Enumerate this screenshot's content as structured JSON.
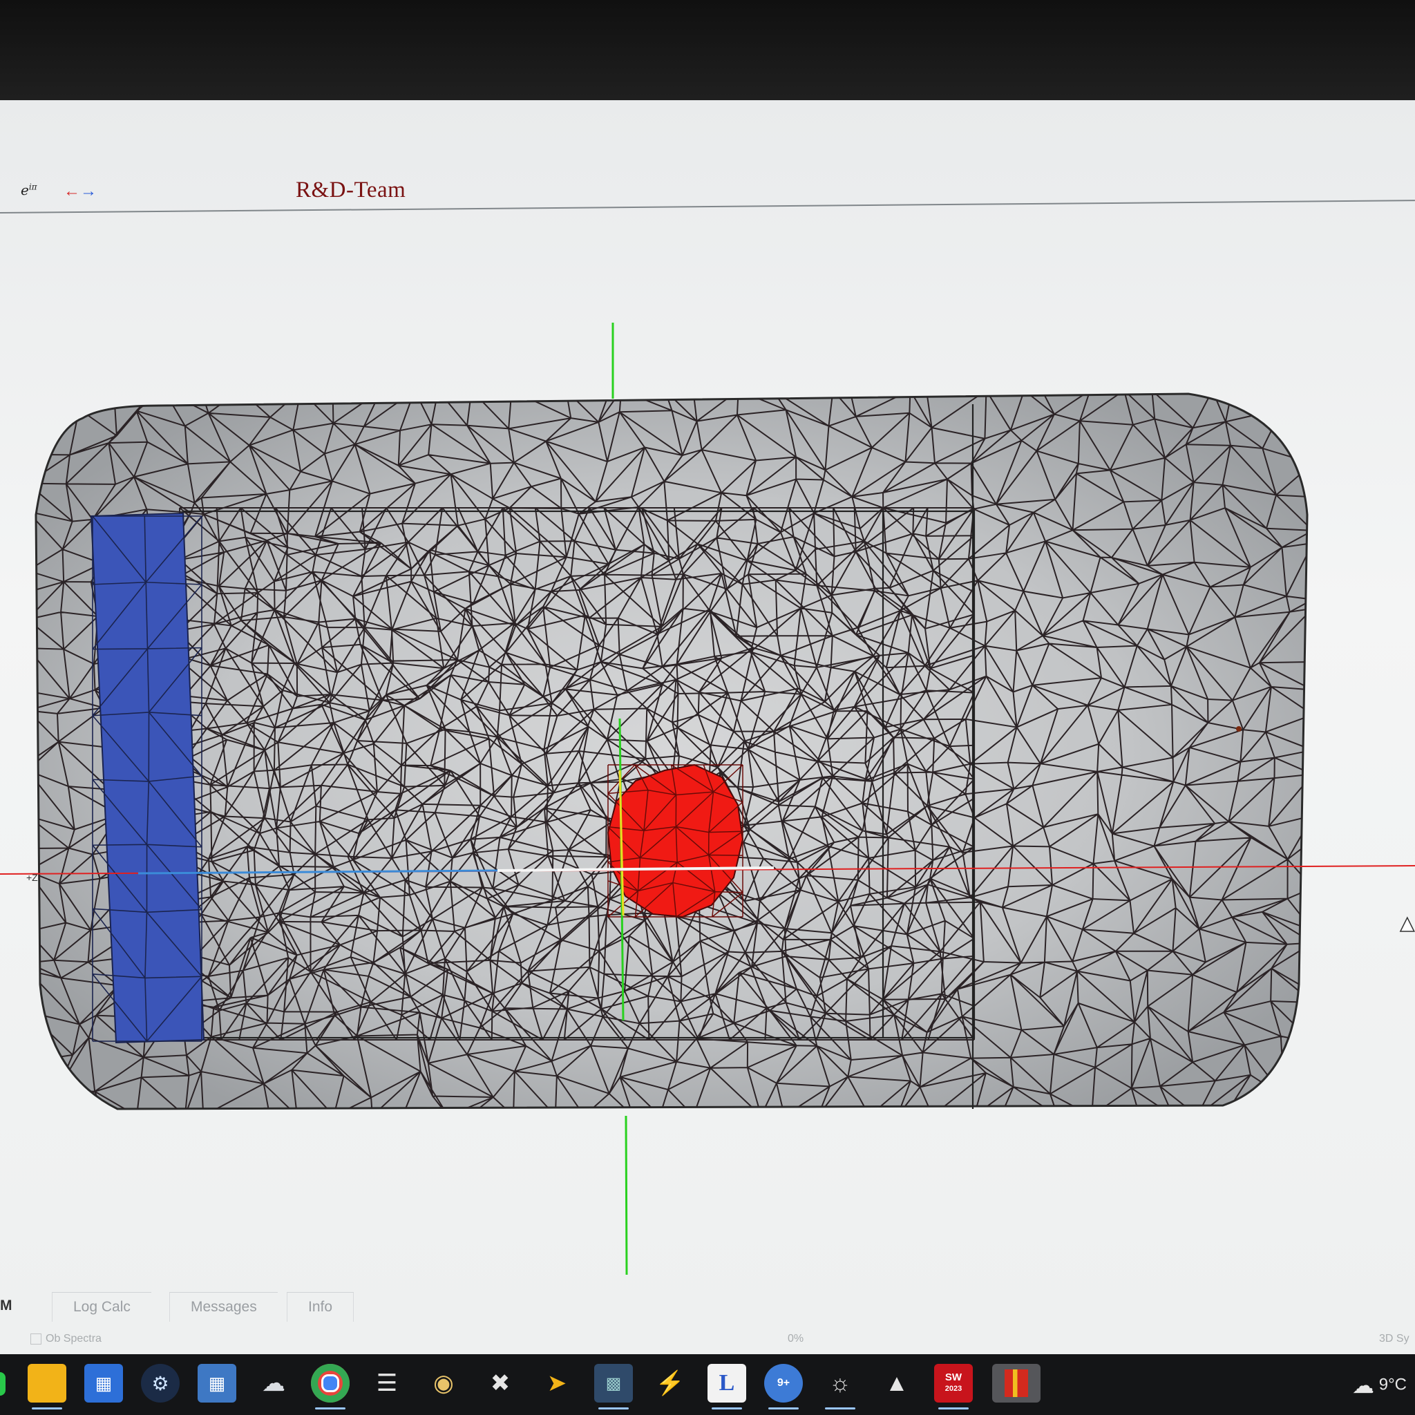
{
  "header": {
    "euler_symbol": "e",
    "euler_exponent": "iπ",
    "arrows_icon": "swap-arrows-icon",
    "title": "R&D-Team"
  },
  "axis_labels": {
    "z_axis_label": "+Z"
  },
  "bottom_tabs": {
    "left_fragment": "M",
    "items": [
      "Log Calc",
      "Messages",
      "Info"
    ]
  },
  "status_bar": {
    "left": "Ob Spectra",
    "center": "0%",
    "right": "3D Sy"
  },
  "taskbar": {
    "icons": [
      "file-explorer-icon",
      "store-icon",
      "steam-icon",
      "calculator-icon",
      "cloud-app-icon",
      "chrome-icon",
      "notes-icon",
      "paint-icon",
      "tool-cross-icon",
      "plugin-icon",
      "app-grid-icon",
      "lightning-icon",
      "l-app-icon",
      "badge-app-icon",
      "satellite-icon",
      "triangle-app-icon",
      "sw-2023-icon",
      "red-app-icon"
    ],
    "badge_label": "9+",
    "sw_label": "SW",
    "sw_year": "2023",
    "weather_icon": "cloud-icon",
    "temperature": "9°C"
  },
  "colors": {
    "title": "#7a1212",
    "blue_plate": "#3b55b8",
    "red_disk": "#f01a14",
    "axis_green": "#29d11f",
    "axis_red": "#e02020"
  }
}
